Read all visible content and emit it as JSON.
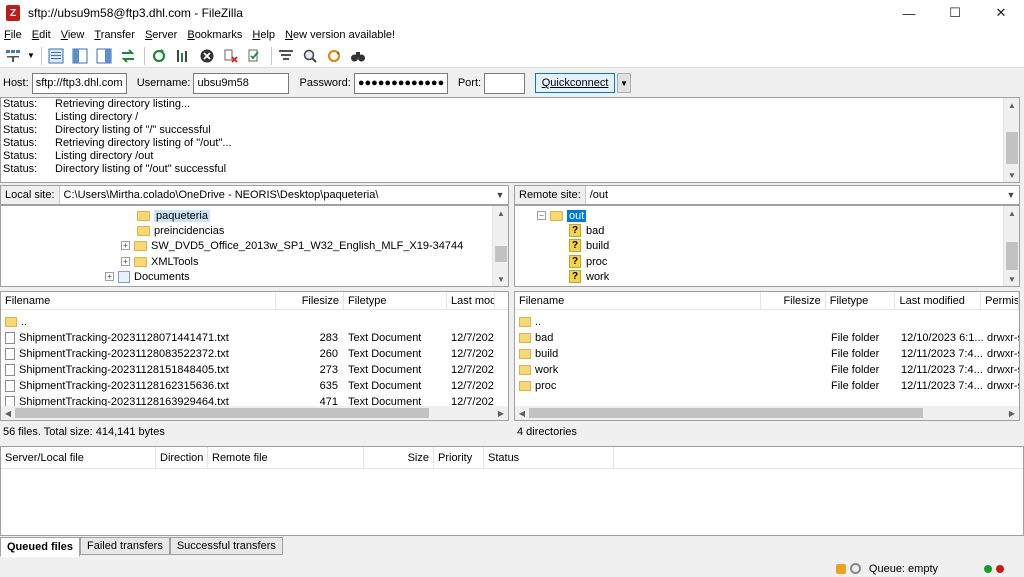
{
  "window": {
    "title": "sftp://ubsu9m58@ftp3.dhl.com - FileZilla",
    "minimize": "—",
    "maximize": "☐",
    "close": "✕"
  },
  "menu": {
    "items": [
      {
        "first": "F",
        "rest": "ile"
      },
      {
        "first": "E",
        "rest": "dit"
      },
      {
        "first": "V",
        "rest": "iew"
      },
      {
        "first": "T",
        "rest": "ransfer"
      },
      {
        "first": "S",
        "rest": "erver"
      },
      {
        "first": "B",
        "rest": "ookmarks"
      },
      {
        "first": "H",
        "rest": "elp"
      },
      {
        "first": "N",
        "rest": "ew version available!"
      }
    ]
  },
  "toolbar_icons": [
    "site-manager",
    "toggle-log",
    "toggle-local-tree",
    "toggle-remote-tree",
    "toggle-queue",
    "refresh",
    "process-queue",
    "cancel",
    "disconnect",
    "reconnect",
    "directory-filter",
    "compare",
    "sync-browse",
    "search"
  ],
  "quickconnect": {
    "host_label": "Host:",
    "host_value": "sftp://ftp3.dhl.com",
    "username_label": "Username:",
    "username_value": "ubsu9m58",
    "password_label": "Password:",
    "password_value": "●●●●●●●●●●●●●●●",
    "port_label": "Port:",
    "port_value": "",
    "button": "Quickconnect",
    "dropdown": "▼"
  },
  "log": [
    {
      "type": "Status:",
      "msg": "Retrieving directory listing..."
    },
    {
      "type": "Status:",
      "msg": "Listing directory /"
    },
    {
      "type": "Status:",
      "msg": "Directory listing of \"/\" successful"
    },
    {
      "type": "Status:",
      "msg": "Retrieving directory listing of \"/out\"..."
    },
    {
      "type": "Status:",
      "msg": "Listing directory /out"
    },
    {
      "type": "Status:",
      "msg": "Directory listing of \"/out\" successful"
    }
  ],
  "local": {
    "label": "Local site:",
    "path": "C:\\Users\\Mirtha.colado\\OneDrive - NEORIS\\Desktop\\paqueteria\\",
    "tree": [
      {
        "name": "paqueteria",
        "selected": true
      },
      {
        "name": "preincidencias"
      },
      {
        "name": "SW_DVD5_Office_2013w_SP1_W32_English_MLF_X19-34744",
        "expander": "+"
      },
      {
        "name": "XMLTools",
        "expander": "+"
      },
      {
        "name": "Documents",
        "expander": "+"
      }
    ],
    "columns": [
      "Filename",
      "Filesize",
      "Filetype",
      "Last modi"
    ],
    "files": [
      {
        "name": "..",
        "size": "",
        "type": "",
        "modified": ""
      },
      {
        "name": "ShipmentTracking-20231128071441471.txt",
        "size": "283",
        "type": "Text Document",
        "modified": "12/7/202"
      },
      {
        "name": "ShipmentTracking-20231128083522372.txt",
        "size": "260",
        "type": "Text Document",
        "modified": "12/7/202"
      },
      {
        "name": "ShipmentTracking-20231128151848405.txt",
        "size": "273",
        "type": "Text Document",
        "modified": "12/7/202"
      },
      {
        "name": "ShipmentTracking-20231128162315636.txt",
        "size": "635",
        "type": "Text Document",
        "modified": "12/7/202"
      },
      {
        "name": "ShipmentTracking-20231128163929464.txt",
        "size": "471",
        "type": "Text Document",
        "modified": "12/7/202"
      }
    ],
    "summary": "56 files. Total size: 414,141 bytes"
  },
  "remote": {
    "label": "Remote site:",
    "path": "/out",
    "tree": [
      {
        "name": "out",
        "selected": true,
        "expander": "−"
      },
      {
        "name": "bad"
      },
      {
        "name": "build"
      },
      {
        "name": "proc"
      },
      {
        "name": "work"
      }
    ],
    "columns": [
      "Filename",
      "Filesize",
      "Filetype",
      "Last modified",
      "Permis"
    ],
    "files": [
      {
        "name": "..",
        "size": "",
        "type": "",
        "modified": "",
        "perms": ""
      },
      {
        "name": "bad",
        "size": "",
        "type": "File folder",
        "modified": "12/10/2023 6:1...",
        "perms": "drwxr-s"
      },
      {
        "name": "build",
        "size": "",
        "type": "File folder",
        "modified": "12/11/2023 7:4...",
        "perms": "drwxr-s"
      },
      {
        "name": "work",
        "size": "",
        "type": "File folder",
        "modified": "12/11/2023 7:4...",
        "perms": "drwxr-s"
      },
      {
        "name": "proc",
        "size": "",
        "type": "File folder",
        "modified": "12/11/2023 7:4...",
        "perms": "drwxr-s"
      }
    ],
    "summary": "4 directories"
  },
  "queue": {
    "columns": [
      "Server/Local file",
      "Direction",
      "Remote file",
      "Size",
      "Priority",
      "Status"
    ],
    "tabs": [
      "Queued files",
      "Failed transfers",
      "Successful transfers"
    ],
    "status": "Queue: empty"
  },
  "colors": {
    "accent": "#0078d7",
    "folder": "#f8d775",
    "selection": "#0078d7"
  }
}
